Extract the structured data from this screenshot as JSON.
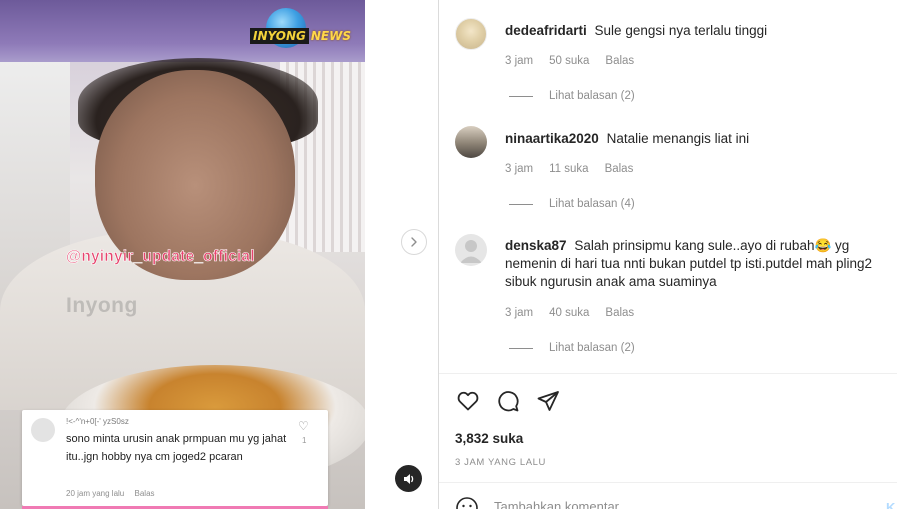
{
  "video": {
    "logo_part1": "INYONG",
    "logo_part2": "NEWS",
    "handle_overlay": "@nyinyir_update_official",
    "watermark": "Inyong",
    "embedded_comment": {
      "user": "!<-^'n+0[-' yzS0sz",
      "text": "sono minta urusin anak prmpuan mu yg jahat itu..jgn hobby nya cm joged2 pcaran",
      "time": "20 jam yang lalu",
      "reply": "Balas",
      "likes": "1",
      "like_icon": "heart-outline-icon"
    },
    "sound_icon": "speaker-icon",
    "next_icon": "chevron-right-icon"
  },
  "comments": [
    {
      "username": "dedeafridarti",
      "text": "Sule gengsi nya terlalu tinggi",
      "time": "3 jam",
      "likes": "50 suka",
      "reply": "Balas",
      "view_replies": "Lihat balasan (2)"
    },
    {
      "username": "ninaartika2020",
      "text": "Natalie menangis liat ini",
      "time": "3 jam",
      "likes": "11 suka",
      "reply": "Balas",
      "view_replies": "Lihat balasan (4)"
    },
    {
      "username": "denska87",
      "text": "Salah prinsipmu kang sule..ayo di rubah😂 yg nemenin di hari tua nnti bukan putdel tp isti.putdel mah pling2 sibuk ngurusin anak ama suaminya",
      "time": "3 jam",
      "likes": "40 suka",
      "reply": "Balas",
      "view_replies": "Lihat balasan (2)"
    }
  ],
  "actions": {
    "icons": [
      "heart-icon",
      "comment-icon",
      "share-icon"
    ]
  },
  "likes_total": "3,832 suka",
  "post_time": "3 JAM YANG LALU",
  "add_comment": {
    "placeholder": "Tambahkan komentar...",
    "post_label": "K"
  },
  "colors": {
    "handle": "#e7436d",
    "text": "#262626",
    "muted": "#8e8e8e",
    "post_disabled": "#b3dbff"
  }
}
